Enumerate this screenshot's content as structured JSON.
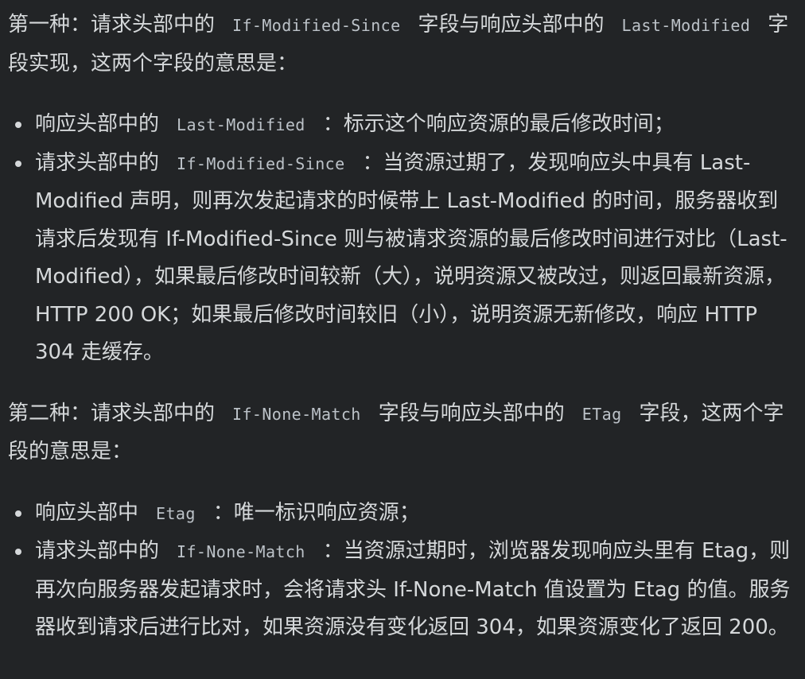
{
  "section1": {
    "intro_part1": "第一种：请求头部中的",
    "header_a": "If-Modified-Since",
    "intro_part2": "字段与响应头部中的",
    "header_b": "Last-Modified",
    "intro_part3": "字段实现，这两个字段的意思是：",
    "items": [
      {
        "prefix": "响应头部中的",
        "code": "Last-Modified",
        "text": "：标示这个响应资源的最后修改时间；"
      },
      {
        "prefix": "请求头部中的",
        "code": "If-Modified-Since",
        "text": "：当资源过期了，发现响应头中具有 Last-Modified 声明，则再次发起请求的时候带上 Last-Modified 的时间，服务器收到请求后发现有 If-Modified-Since 则与被请求资源的最后修改时间进行对比（Last-Modified），如果最后修改时间较新（大），说明资源又被改过，则返回最新资源，HTTP 200 OK；如果最后修改时间较旧（小），说明资源无新修改，响应 HTTP 304 走缓存。"
      }
    ]
  },
  "section2": {
    "intro_part1": "第二种：请求头部中的",
    "header_a": "If-None-Match",
    "intro_part2": "字段与响应头部中的",
    "header_b": "ETag",
    "intro_part3": "字段，这两个字段的意思是：",
    "items": [
      {
        "prefix": "响应头部中",
        "code": "Etag",
        "text": "：唯一标识响应资源；"
      },
      {
        "prefix": "请求头部中的",
        "code": "If-None-Match",
        "text": "：当资源过期时，浏览器发现响应头里有 Etag，则再次向服务器发起请求时，会将请求头 If-None-Match 值设置为 Etag 的值。服务器收到请求后进行比对，如果资源没有变化返回 304，如果资源变化了返回 200。"
      }
    ]
  }
}
